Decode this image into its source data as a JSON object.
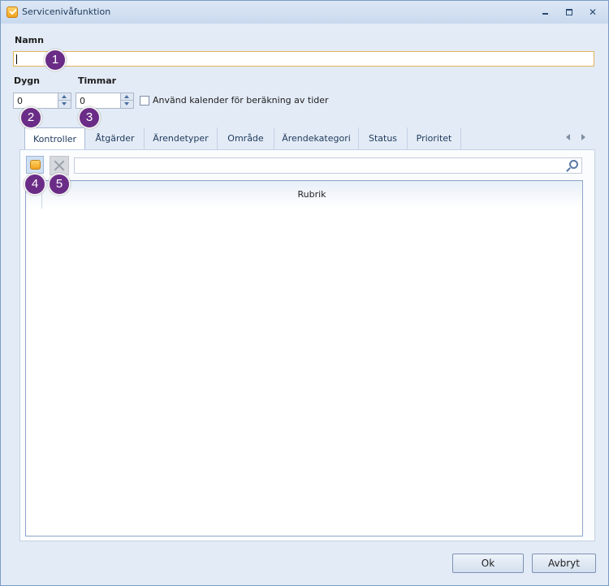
{
  "window": {
    "title": "Servicenivåfunktion"
  },
  "form": {
    "name_label": "Namn",
    "name_value": "",
    "days_label": "Dygn",
    "days_value": "0",
    "hours_label": "Timmar",
    "hours_value": "0",
    "calendar_checkbox_label": "Använd kalender för beräkning av tider",
    "calendar_checked": false
  },
  "tabs": [
    "Kontroller",
    "Åtgärder",
    "Ärendetyper",
    "Område",
    "Ärendekategori",
    "Status",
    "Prioritet"
  ],
  "active_tab": "Kontroller",
  "grid": {
    "columns": [
      "Rubrik"
    ],
    "rows": []
  },
  "buttons": {
    "ok": "Ok",
    "cancel": "Avbryt"
  },
  "callouts": [
    "1",
    "2",
    "3",
    "4",
    "5"
  ],
  "colors": {
    "callout": "#6a2c86",
    "focus_border": "#e2b45a"
  }
}
